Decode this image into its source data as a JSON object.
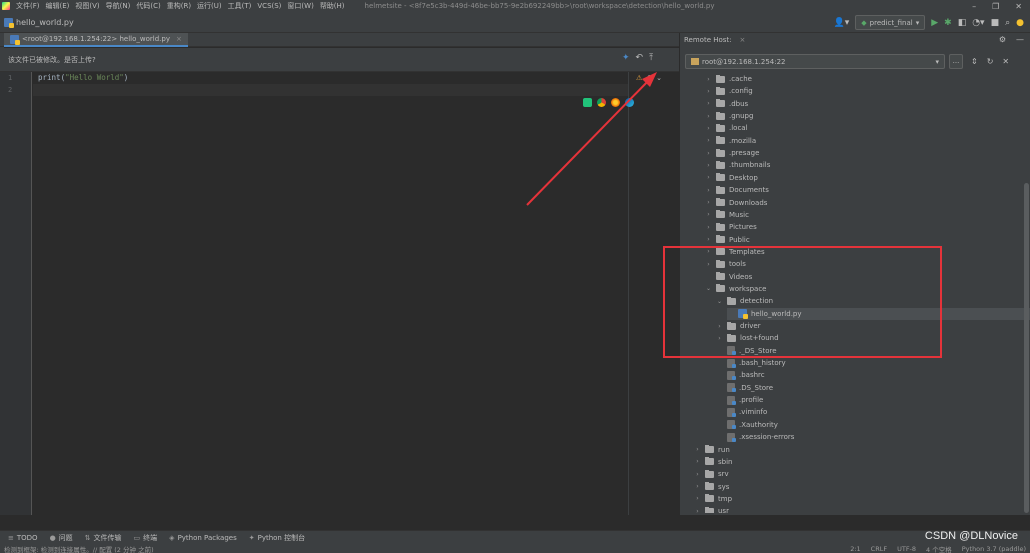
{
  "menubar": {
    "items": [
      "文件(F)",
      "编辑(E)",
      "视图(V)",
      "导航(N)",
      "代码(C)",
      "重构(R)",
      "运行(U)",
      "工具(T)",
      "VCS(S)",
      "窗口(W)",
      "帮助(H)"
    ],
    "window_title": "helmetsite - <8f7e5c3b-449d-46be-bb75-9e2b692249bb>\\root\\workspace\\detection\\hello_world.py"
  },
  "navbar": {
    "breadcrumb": "hello_world.py",
    "run_config": "predict_final"
  },
  "editor": {
    "tab_label": "<root@192.168.1.254:22> hello_world.py",
    "tab_close": "×",
    "banner_text": "该文件已被修改。是否上传?",
    "line_numbers": [
      "1",
      "2"
    ],
    "code_fn": "print",
    "code_open": "(",
    "code_string": "\"Hello World\"",
    "code_close": ")"
  },
  "remote_panel": {
    "title": "Remote Host:",
    "close": "×",
    "host": "root@192.168.1.254:22",
    "browse": "...",
    "tree": [
      {
        "label": ".cache",
        "kind": "folder",
        "depth": 1,
        "expanded": false
      },
      {
        "label": ".config",
        "kind": "folder",
        "depth": 1,
        "expanded": false
      },
      {
        "label": ".dbus",
        "kind": "folder",
        "depth": 1,
        "expanded": false
      },
      {
        "label": ".gnupg",
        "kind": "folder",
        "depth": 1,
        "expanded": false
      },
      {
        "label": ".local",
        "kind": "folder",
        "depth": 1,
        "expanded": false
      },
      {
        "label": ".mozilla",
        "kind": "folder",
        "depth": 1,
        "expanded": false
      },
      {
        "label": ".presage",
        "kind": "folder",
        "depth": 1,
        "expanded": false
      },
      {
        "label": ".thumbnails",
        "kind": "folder",
        "depth": 1,
        "expanded": false
      },
      {
        "label": "Desktop",
        "kind": "folder",
        "depth": 1,
        "expanded": false
      },
      {
        "label": "Documents",
        "kind": "folder",
        "depth": 1,
        "expanded": false
      },
      {
        "label": "Downloads",
        "kind": "folder",
        "depth": 1,
        "expanded": false
      },
      {
        "label": "Music",
        "kind": "folder",
        "depth": 1,
        "expanded": false
      },
      {
        "label": "Pictures",
        "kind": "folder",
        "depth": 1,
        "expanded": false
      },
      {
        "label": "Public",
        "kind": "folder",
        "depth": 1,
        "expanded": false
      },
      {
        "label": "Templates",
        "kind": "folder",
        "depth": 1,
        "expanded": false
      },
      {
        "label": "tools",
        "kind": "folder",
        "depth": 1,
        "expanded": false
      },
      {
        "label": "Videos",
        "kind": "folder",
        "depth": 1,
        "expanded": null
      },
      {
        "label": "workspace",
        "kind": "folder",
        "depth": 1,
        "expanded": true
      },
      {
        "label": "detection",
        "kind": "folder",
        "depth": 2,
        "expanded": true
      },
      {
        "label": "hello_world.py",
        "kind": "py",
        "depth": 3,
        "expanded": null,
        "selected": true
      },
      {
        "label": "driver",
        "kind": "folder",
        "depth": 2,
        "expanded": false
      },
      {
        "label": "lost+found",
        "kind": "folder",
        "depth": 2,
        "expanded": false
      },
      {
        "label": "._DS_Store",
        "kind": "file",
        "depth": 2,
        "expanded": null
      },
      {
        "label": ".bash_history",
        "kind": "file",
        "depth": 2,
        "expanded": null
      },
      {
        "label": ".bashrc",
        "kind": "file",
        "depth": 2,
        "expanded": null
      },
      {
        "label": ".DS_Store",
        "kind": "file",
        "depth": 2,
        "expanded": null
      },
      {
        "label": ".profile",
        "kind": "file",
        "depth": 2,
        "expanded": null
      },
      {
        "label": ".viminfo",
        "kind": "file",
        "depth": 2,
        "expanded": null
      },
      {
        "label": ".Xauthority",
        "kind": "file",
        "depth": 2,
        "expanded": null
      },
      {
        "label": ".xsession-errors",
        "kind": "file",
        "depth": 2,
        "expanded": null
      },
      {
        "label": "run",
        "kind": "folder",
        "depth": 0,
        "expanded": false
      },
      {
        "label": "sbin",
        "kind": "folder",
        "depth": 0,
        "expanded": false
      },
      {
        "label": "srv",
        "kind": "folder",
        "depth": 0,
        "expanded": false
      },
      {
        "label": "sys",
        "kind": "folder",
        "depth": 0,
        "expanded": false
      },
      {
        "label": "tmp",
        "kind": "folder",
        "depth": 0,
        "expanded": false
      },
      {
        "label": "usr",
        "kind": "folder",
        "depth": 0,
        "expanded": false
      },
      {
        "label": "var",
        "kind": "folder",
        "depth": 0,
        "expanded": false
      }
    ]
  },
  "bottom_bar": {
    "items": [
      {
        "icon": "≡",
        "label": "TODO"
      },
      {
        "icon": "●",
        "label": "问题"
      },
      {
        "icon": "⇅",
        "label": "文件传输"
      },
      {
        "icon": "▭",
        "label": "终端"
      },
      {
        "icon": "◈",
        "label": "Python Packages"
      },
      {
        "icon": "✦",
        "label": "Python 控制台"
      }
    ]
  },
  "statusbar": {
    "left": "检测到框架: 检测到连接属性。// 配置 (2 分钟 之前)",
    "right": [
      "2:1",
      "CRLF",
      "UTF-8",
      "4 个空格",
      "Python 3.7 (paddle)"
    ]
  },
  "watermark": "CSDN @DLNovice",
  "colors": {
    "annotation_red": "#e5333a",
    "run_green": "#59a869",
    "tab_underline": "#4a88c7"
  }
}
